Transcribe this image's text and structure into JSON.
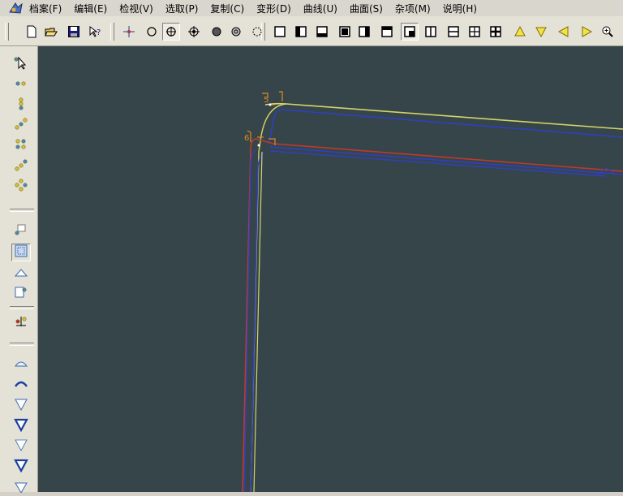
{
  "menu": {
    "items": [
      "档案(F)",
      "编辑(E)",
      "检视(V)",
      "选取(P)",
      "复制(C)",
      "变形(D)",
      "曲线(U)",
      "曲面(S)",
      "杂项(M)",
      "说明(H)"
    ]
  },
  "toolbar": {
    "buttons": [
      {
        "name": "new-file-icon"
      },
      {
        "name": "open-file-icon"
      },
      {
        "name": "save-icon"
      },
      {
        "name": "help-pointer-icon"
      },
      {
        "name": "center-point-icon"
      },
      {
        "name": "circle-snap-icon"
      },
      {
        "name": "crosshair-circle-icon"
      },
      {
        "name": "target-icon"
      },
      {
        "name": "filled-circle-icon"
      },
      {
        "name": "ring-circle-icon"
      },
      {
        "name": "dashed-circle-icon"
      },
      {
        "name": "view-single-icon"
      },
      {
        "name": "view-left-icon"
      },
      {
        "name": "view-bottom-icon"
      },
      {
        "name": "view-full-icon"
      },
      {
        "name": "view-right-icon"
      },
      {
        "name": "view-top-icon"
      },
      {
        "name": "view-quad-corner-icon"
      },
      {
        "name": "split-vertical-icon"
      },
      {
        "name": "split-horizontal-icon"
      },
      {
        "name": "split-quad-icon"
      },
      {
        "name": "split-quad-bold-icon"
      },
      {
        "name": "triangle-up-icon"
      },
      {
        "name": "triangle-down-icon"
      },
      {
        "name": "triangle-left-icon"
      },
      {
        "name": "triangle-right-icon"
      },
      {
        "name": "zoom-in-icon"
      }
    ]
  },
  "palette": {
    "buttons": [
      "select-arrow-icon",
      "point-pair-icon",
      "point-stack-icon",
      "point-diagonal-icon",
      "point-grid-icon",
      "point-scatter-icon",
      "point-cluster-icon",
      "frame-small-icon",
      "frame-dotted-icon",
      "triangle-outline-icon",
      "frame-corner-icon",
      "move-points-icon",
      "surface-arc-icon",
      "surface-arc-bold-icon",
      "surface-down-icon",
      "surface-down-bold-icon",
      "surface-down-thin-icon",
      "surface-down-solid-icon",
      "surface-partial-icon"
    ]
  },
  "viewport": {
    "background": "#364549",
    "curve_colors": {
      "yellow": "#d4d46a",
      "red": "#c0392b",
      "blue": "#2f3fc4",
      "label": "#e08a1e"
    }
  }
}
